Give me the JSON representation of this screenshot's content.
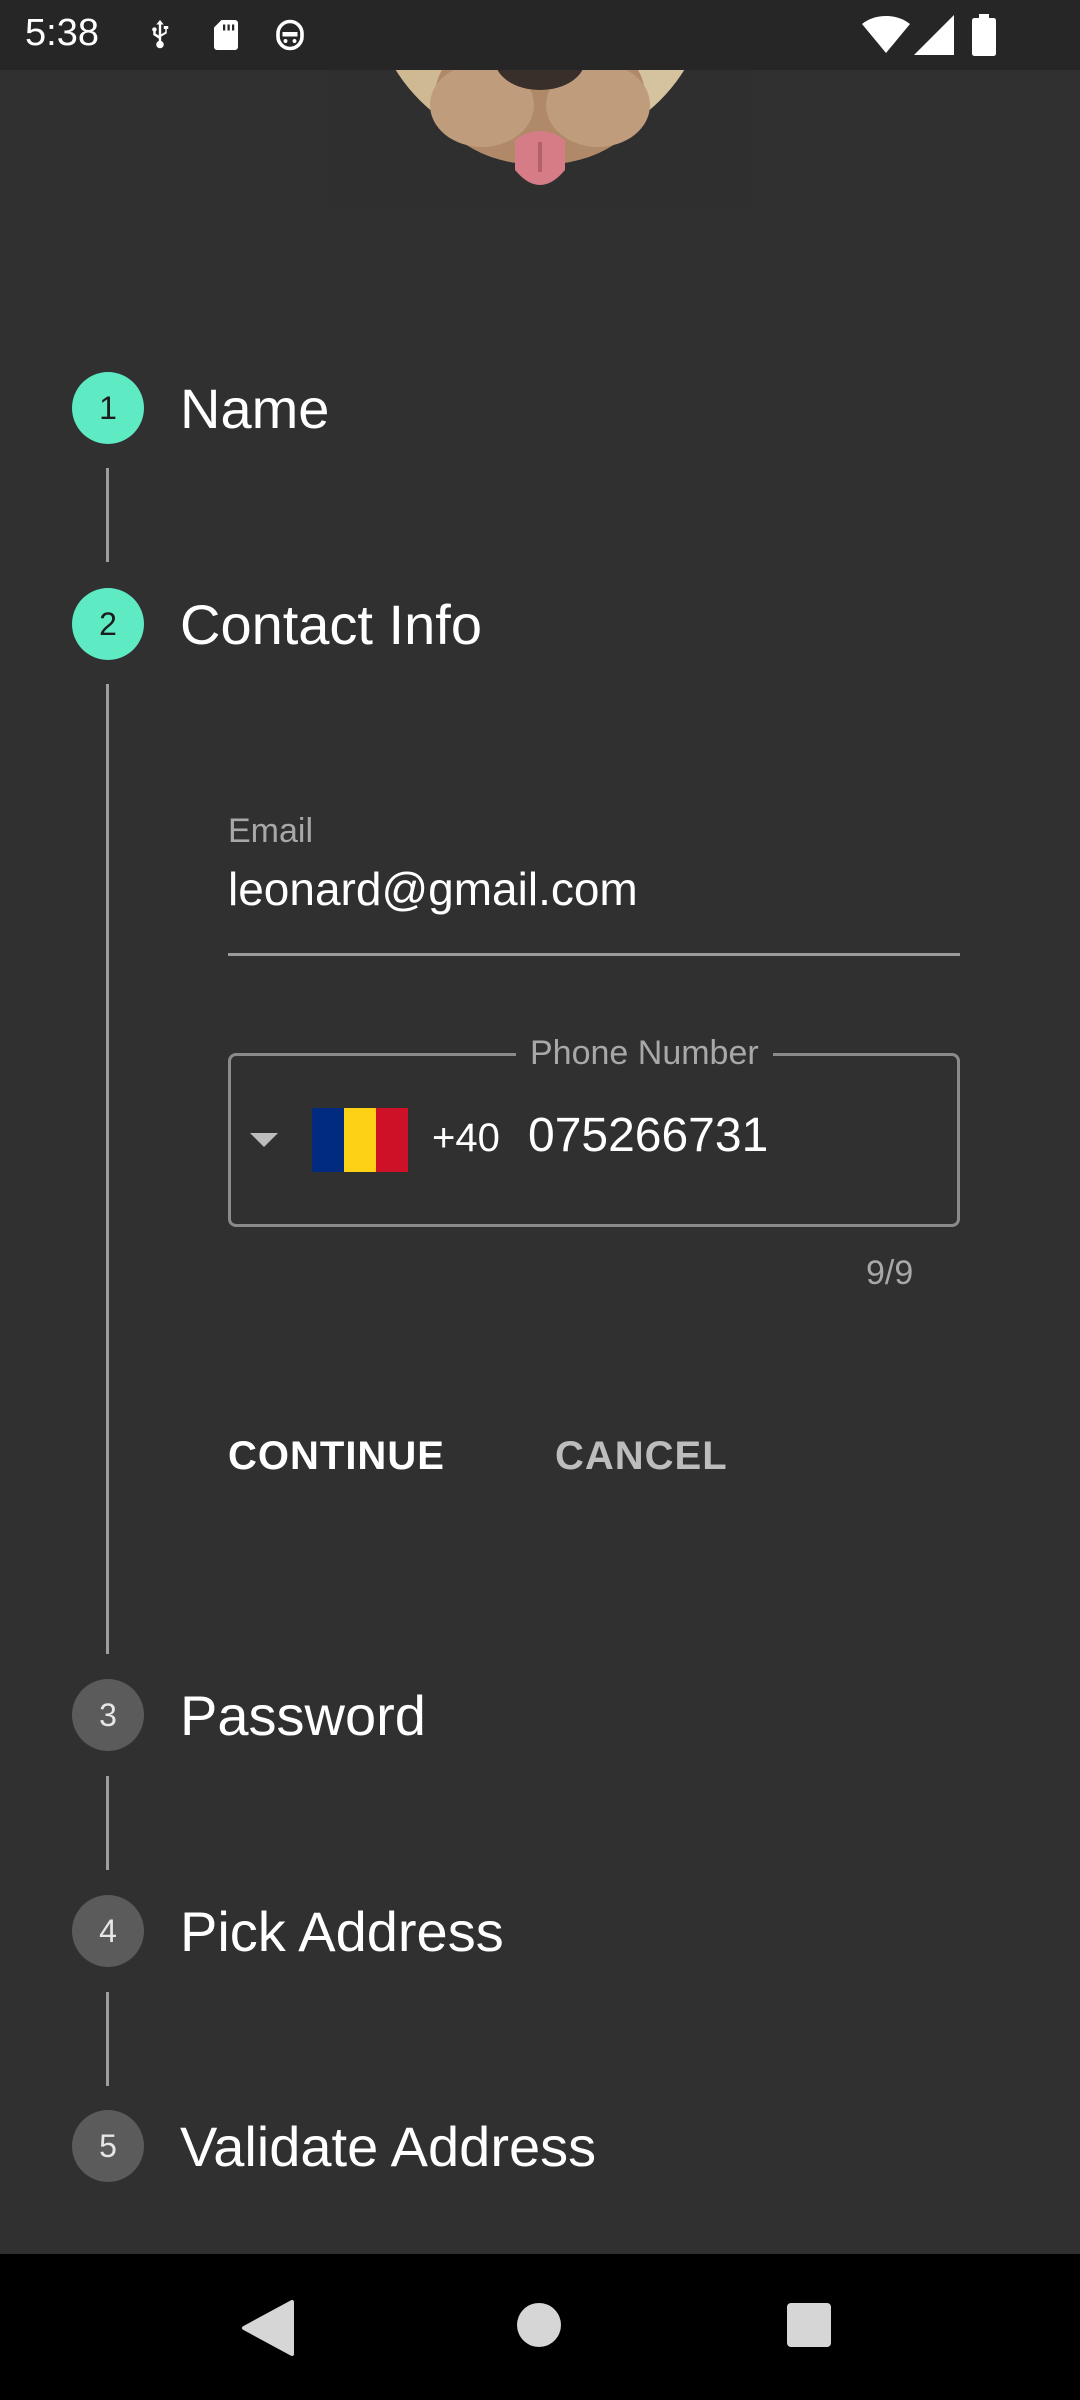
{
  "status_bar": {
    "time": "5:38",
    "left_icons": [
      "usb-debug-icon",
      "sd-card-icon",
      "assistant-icon"
    ],
    "right_icons": [
      "wifi-icon",
      "signal-icon",
      "battery-icon"
    ]
  },
  "mascot": {
    "icon": "dog-face-icon"
  },
  "stepper": {
    "steps": [
      {
        "number": "1",
        "title": "Name",
        "state": "done"
      },
      {
        "number": "2",
        "title": "Contact Info",
        "state": "active"
      },
      {
        "number": "3",
        "title": "Password",
        "state": "inactive"
      },
      {
        "number": "4",
        "title": "Pick Address",
        "state": "inactive"
      },
      {
        "number": "5",
        "title": "Validate Address",
        "state": "inactive"
      }
    ],
    "active_color": "#5eebc4",
    "inactive_color": "#5b5b5b"
  },
  "contact_form": {
    "email": {
      "label": "Email",
      "value": "leonard@gmail.com"
    },
    "phone": {
      "label": "Phone Number",
      "country_flag": "romania-flag-icon",
      "flag_colors": [
        "#002b7f",
        "#fcd116",
        "#ce1126"
      ],
      "dial_code": "+40",
      "value": "075266731",
      "counter": "9/9"
    },
    "continue_label": "CONTINUE",
    "cancel_label": "CANCEL"
  },
  "nav_bar": {
    "icons": [
      "back-icon",
      "home-icon",
      "recents-icon"
    ]
  }
}
